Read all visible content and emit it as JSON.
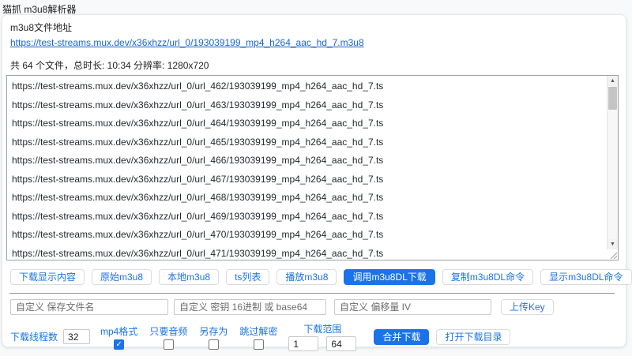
{
  "page": {
    "title": "猫抓 m3u8解析器"
  },
  "address": {
    "label": "m3u8文件地址",
    "url": "https://test-streams.mux.dev/x36xhzz/url_0/193039199_mp4_h264_aac_hd_7.m3u8"
  },
  "summary": {
    "text": "共 64 个文件，总时长: 10:34 分辨率: 1280x720"
  },
  "segment_list": {
    "lines": [
      "https://test-streams.mux.dev/x36xhzz/url_0/url_462/193039199_mp4_h264_aac_hd_7.ts",
      "https://test-streams.mux.dev/x36xhzz/url_0/url_463/193039199_mp4_h264_aac_hd_7.ts",
      "https://test-streams.mux.dev/x36xhzz/url_0/url_464/193039199_mp4_h264_aac_hd_7.ts",
      "https://test-streams.mux.dev/x36xhzz/url_0/url_465/193039199_mp4_h264_aac_hd_7.ts",
      "https://test-streams.mux.dev/x36xhzz/url_0/url_466/193039199_mp4_h264_aac_hd_7.ts",
      "https://test-streams.mux.dev/x36xhzz/url_0/url_467/193039199_mp4_h264_aac_hd_7.ts",
      "https://test-streams.mux.dev/x36xhzz/url_0/url_468/193039199_mp4_h264_aac_hd_7.ts",
      "https://test-streams.mux.dev/x36xhzz/url_0/url_469/193039199_mp4_h264_aac_hd_7.ts",
      "https://test-streams.mux.dev/x36xhzz/url_0/url_470/193039199_mp4_h264_aac_hd_7.ts",
      "https://test-streams.mux.dev/x36xhzz/url_0/url_471/193039199_mp4_h264_aac_hd_7.ts"
    ]
  },
  "actions": {
    "buttons": [
      "下载显示内容",
      "原始m3u8",
      "本地m3u8",
      "ts列表",
      "播放m3u8",
      "调用m3u8DL下载",
      "复制m3u8DL命令",
      "显示m3u8DL命令"
    ]
  },
  "custom": {
    "filename_placeholder": "自定义 保存文件名",
    "key_placeholder": "自定义 密钥 16进制 或 base64",
    "iv_placeholder": "自定义 偏移量 IV",
    "upload_key_label": "上传Key"
  },
  "download": {
    "threads_label": "下载线程数",
    "threads_value": "32",
    "checkboxes": [
      {
        "label": "mp4格式",
        "checked": true
      },
      {
        "label": "只要音频",
        "checked": false
      },
      {
        "label": "另存为",
        "checked": false
      },
      {
        "label": "跳过解密",
        "checked": false
      }
    ],
    "range_label": "下载范围",
    "range_from": "1",
    "range_to": "64",
    "merge_label": "合并下载",
    "open_dir_label": "打开下载目录"
  },
  "icons": {
    "scroll_up": "▲",
    "scroll_down": "▼",
    "checkmark": "✓"
  },
  "colors": {
    "accent": "#1a73e8",
    "link": "#1765cc"
  }
}
